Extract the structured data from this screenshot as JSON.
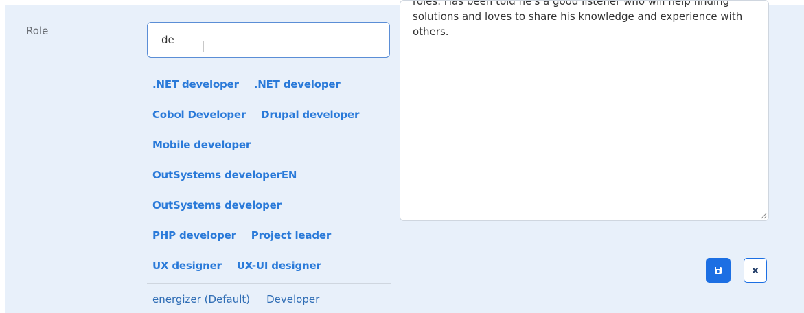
{
  "form": {
    "role_label": "Role",
    "role_input_value": "de"
  },
  "suggestions": {
    "rows": [
      [
        ".NET developer",
        ".NET developer"
      ],
      [
        "Cobol Developer",
        "Drupal developer"
      ],
      [
        "Mobile developer"
      ],
      [
        "OutSystems developerEN"
      ],
      [
        "OutSystems developer"
      ],
      [
        "PHP developer",
        "Project leader"
      ],
      [
        "UX designer",
        "UX-UI designer"
      ]
    ],
    "footer": [
      "energizer (Default)",
      "Developer"
    ]
  },
  "bio": {
    "text": "roles. Has been told he's a good listener who will help finding solutions and loves to share his knowledge and experience with others."
  },
  "actions": {
    "save_icon": "floppy-disk-icon",
    "close_icon": "close-icon"
  },
  "colors": {
    "panel_bg": "#e8f0fa",
    "link_blue": "#2a7ad9",
    "primary": "#1c6fe3"
  }
}
